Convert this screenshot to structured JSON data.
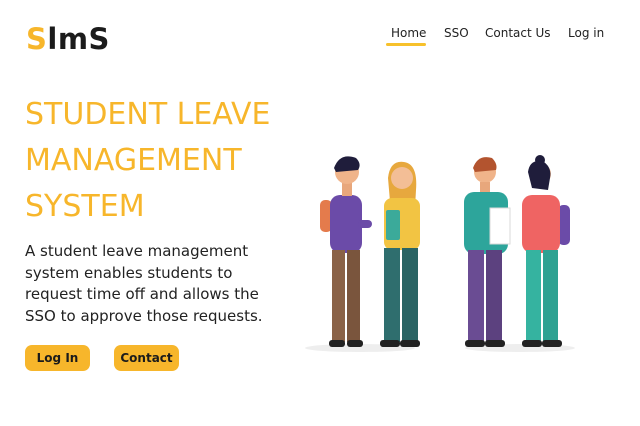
{
  "logo": {
    "accent": "S",
    "rest": "lmS"
  },
  "nav": {
    "home": "Home",
    "sso": "SSO",
    "contact": "Contact Us",
    "login": "Log in"
  },
  "hero": {
    "title_lines": [
      "STUDENT LEAVE",
      "MANAGEMENT",
      "SYSTEM"
    ],
    "description": "A student leave management system enables students to request time off and allows the SSO to approve those requests."
  },
  "buttons": {
    "login": "Log In",
    "contact": "Contact"
  },
  "colors": {
    "accent": "#F7B62B",
    "text": "#222222"
  },
  "illustration": {
    "icon": "students-group-illustration"
  }
}
